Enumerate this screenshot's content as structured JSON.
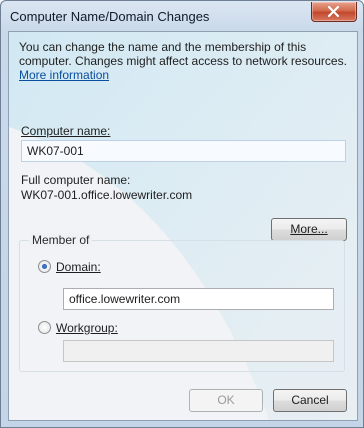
{
  "window": {
    "title": "Computer Name/Domain Changes"
  },
  "intro": {
    "description": "You can change the name and the membership of this computer. Changes might affect access to network resources.",
    "more_information_link": "More information"
  },
  "computer_name": {
    "label": "Computer name:",
    "value": "WK07-001"
  },
  "full_name": {
    "label": "Full computer name:",
    "value": "WK07-001.office.lowewriter.com"
  },
  "more_button": {
    "label": "More..."
  },
  "member_of": {
    "legend": "Member of",
    "domain": {
      "label": "Domain:",
      "selected": true,
      "value": "office.lowewriter.com"
    },
    "workgroup": {
      "label": "Workgroup:",
      "selected": false,
      "value": ""
    }
  },
  "buttons": {
    "ok": "OK",
    "cancel": "Cancel"
  },
  "colors": {
    "accent": "#0a4ea0",
    "close_button": "#c2472c"
  }
}
